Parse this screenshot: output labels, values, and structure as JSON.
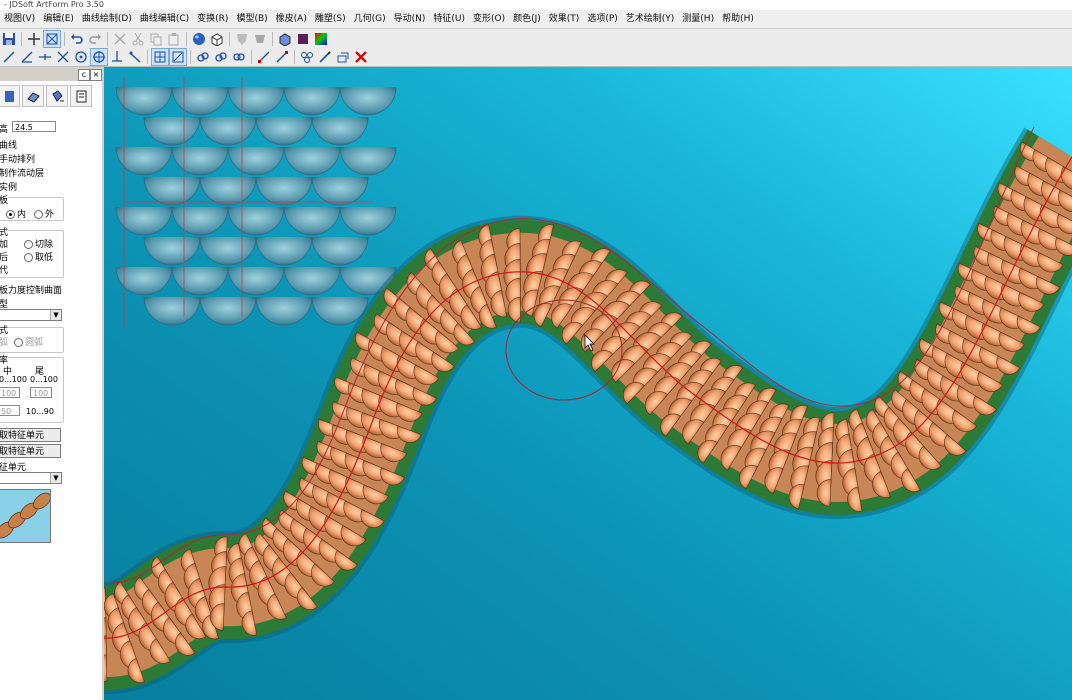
{
  "window": {
    "title": "- JDSoft ArtForm Pro 3.50"
  },
  "menubar": {
    "items": [
      "视图(V)",
      "编辑(E)",
      "曲线绘制(D)",
      "曲线编辑(C)",
      "变换(R)",
      "模型(B)",
      "橡皮(A)",
      "雕塑(S)",
      "几何(G)",
      "导动(N)",
      "特征(U)",
      "变形(O)",
      "颜色(J)",
      "效果(T)",
      "选项(P)",
      "艺术绘制(Y)",
      "测量(H)",
      "帮助(H)"
    ]
  },
  "panel": {
    "height_label": "高",
    "height_value": "24.5",
    "opt_curve": "曲线",
    "opt_auto_arrange": "手动排列",
    "opt_flow_layer": "制作流动层",
    "opt_instance": "实例",
    "plate_label": "板",
    "inner": "内",
    "outer": "外",
    "mode_label": "式",
    "add": "加",
    "cut": "切除",
    "upper": "后",
    "lower": "取低",
    "replace": "代",
    "stiffness_label": "板力度控制曲面",
    "type_label": "型",
    "style_label": "式",
    "style_a": "弧",
    "style_b": "圆弧",
    "scale_label": "率",
    "mid_label": "中",
    "tail_label": "尾",
    "range_a": "0...100",
    "range_b": "0...100",
    "val_a": "100",
    "val_b": "100",
    "val_c": "50",
    "range_c": "10...90",
    "btn_feature1": "取特征单元",
    "btn_feature2": "取特征单元",
    "feature_label": "征单元"
  },
  "icons": {
    "tb1": [
      "save-icon",
      "grid-icon",
      "select-box-icon",
      "undo-icon",
      "redo-icon",
      "cut-icon",
      "scissors-icon",
      "copy-icon",
      "paste-icon",
      "sphere-icon",
      "cube-icon",
      "shield-icon",
      "shield2-icon",
      "color-cube-icon",
      "block-icon",
      "palette-icon"
    ],
    "tb2": [
      "line-icon",
      "angle-icon",
      "move-icon",
      "cross-icon",
      "circle-icon",
      "circle2-icon",
      "anchor-icon",
      "wand-icon",
      "snap-grid-icon",
      "snap-point-icon",
      "link-icon",
      "link2-icon",
      "link3-icon",
      "node-icon",
      "node2-icon",
      "cluster-icon",
      "brush-icon",
      "layer-icon",
      "delete-icon"
    ]
  },
  "colors": {
    "viewport_top": "#3be0ff",
    "viewport_bottom": "#087e9e",
    "scale_core": "#f1a371",
    "scale_edge": "#2e8a3a",
    "guide": "#d01818"
  }
}
